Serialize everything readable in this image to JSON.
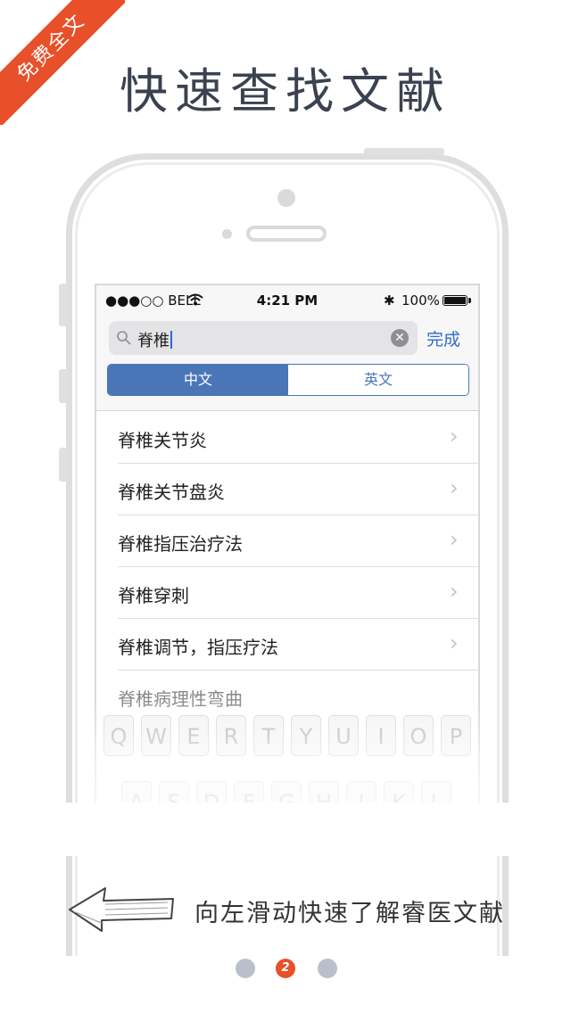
{
  "ribbon": {
    "text": "免费全文"
  },
  "headline": "快速查找文献",
  "statusbar": {
    "carrier": "●●●○○ BELL",
    "time": "4:21 PM",
    "bluetooth": "✱",
    "battery": "100%"
  },
  "search": {
    "query": "脊椎",
    "clear": "✕",
    "done": "完成"
  },
  "segments": [
    "中文",
    "英文"
  ],
  "results": [
    "脊椎关节炎",
    "脊椎关节盘炎",
    "脊椎指压治疗法",
    "脊椎穿刺",
    "脊椎调节，指压疗法",
    "脊椎病理性弯曲"
  ],
  "chevron": "›",
  "keyboard": {
    "row1": [
      "Q",
      "W",
      "E",
      "R",
      "T",
      "Y",
      "U",
      "I",
      "O",
      "P"
    ],
    "row2": [
      "A",
      "S",
      "D",
      "F",
      "G",
      "H",
      "J",
      "K",
      "L"
    ]
  },
  "hint": "向左滑动快速了解睿医文献",
  "pager": {
    "active": "2"
  },
  "colors": {
    "accent": "#e8502a",
    "segment": "#4a76b8",
    "link": "#2f6dc8"
  }
}
